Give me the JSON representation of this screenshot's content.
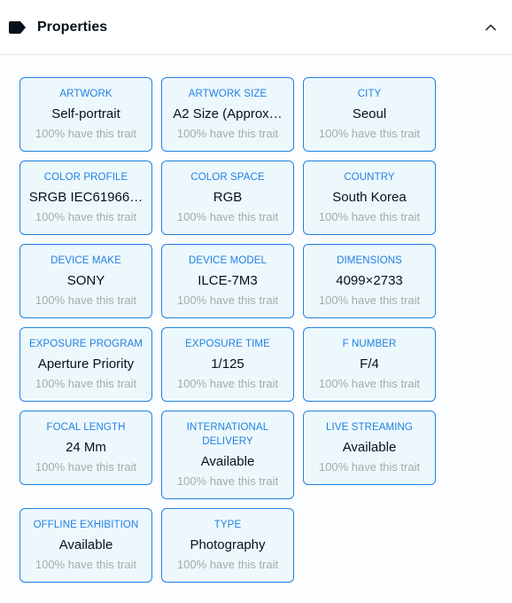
{
  "header": {
    "title": "Properties",
    "icon": "tag-icon",
    "toggle_icon": "chevron-up-icon"
  },
  "colors": {
    "accent": "#2081e2",
    "border_light": "#e5e8eb",
    "text_primary": "#04111d",
    "text_muted": "#a7a9ad"
  },
  "traits": [
    {
      "type": "ARTWORK",
      "value": "Self-portrait",
      "rarity": "100% have this trait"
    },
    {
      "type": "ARTWORK SIZE",
      "value": "A2 Size (Approx…",
      "rarity": "100% have this trait"
    },
    {
      "type": "CITY",
      "value": "Seoul",
      "rarity": "100% have this trait"
    },
    {
      "type": "COLOR PROFILE",
      "value": "SRGB IEC61966…",
      "rarity": "100% have this trait"
    },
    {
      "type": "COLOR SPACE",
      "value": "RGB",
      "rarity": "100% have this trait"
    },
    {
      "type": "COUNTRY",
      "value": "South Korea",
      "rarity": "100% have this trait"
    },
    {
      "type": "DEVICE MAKE",
      "value": "SONY",
      "rarity": "100% have this trait"
    },
    {
      "type": "DEVICE MODEL",
      "value": "ILCE-7M3",
      "rarity": "100% have this trait"
    },
    {
      "type": "DIMENSIONS",
      "value": "4099×2733",
      "rarity": "100% have this trait"
    },
    {
      "type": "EXPOSURE PROGRAM",
      "value": "Aperture Priority",
      "rarity": "100% have this trait"
    },
    {
      "type": "EXPOSURE TIME",
      "value": "1/125",
      "rarity": "100% have this trait"
    },
    {
      "type": "F NUMBER",
      "value": "F/4",
      "rarity": "100% have this trait"
    },
    {
      "type": "FOCAL LENGTH",
      "value": "24 Mm",
      "rarity": "100% have this trait"
    },
    {
      "type": "INTERNATIONAL DELIVERY",
      "value": "Available",
      "rarity": "100% have this trait"
    },
    {
      "type": "LIVE STREAMING",
      "value": "Available",
      "rarity": "100% have this trait"
    },
    {
      "type": "OFFLINE EXHIBITION",
      "value": "Available",
      "rarity": "100% have this trait"
    },
    {
      "type": "TYPE",
      "value": "Photography",
      "rarity": "100% have this trait"
    }
  ]
}
